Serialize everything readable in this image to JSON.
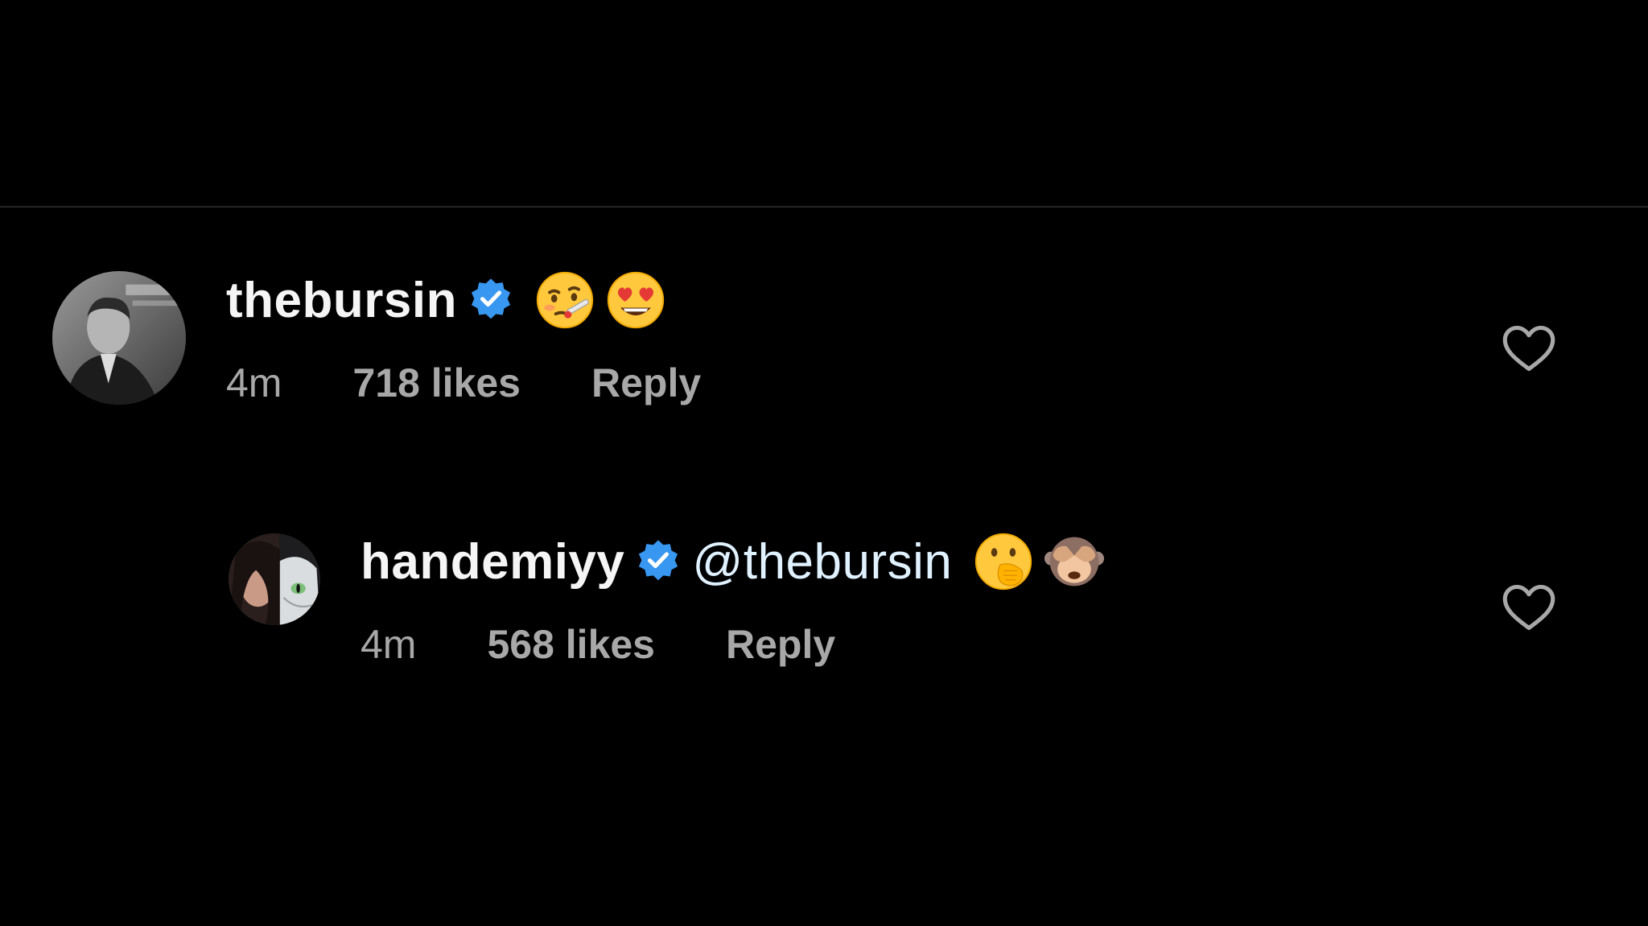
{
  "comments": [
    {
      "username": "thebursin",
      "verified": true,
      "mention": "",
      "emojis": [
        "woozy-face-thermometer",
        "heart-eyes"
      ],
      "time": "4m",
      "likes": "718 likes",
      "reply_label": "Reply",
      "avatar": "avatar-photo"
    },
    {
      "username": "handemiyy",
      "verified": true,
      "mention": "@thebursin",
      "emojis": [
        "face-with-hand-over-mouth",
        "see-no-evil-monkey"
      ],
      "time": "4m",
      "likes": "568 likes",
      "reply_label": "Reply",
      "avatar": "avatar-photo"
    }
  ],
  "colors": {
    "background": "#000000",
    "primary_text": "#f5f5f5",
    "secondary_text": "#a8a8a8",
    "verified_badge": "#3897f0",
    "mention": "#e0f1ff",
    "divider": "#262626"
  }
}
